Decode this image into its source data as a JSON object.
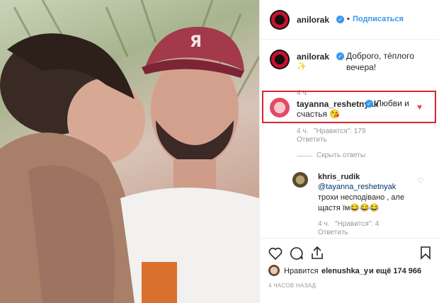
{
  "post": {
    "author": "anilorak",
    "follow_label": "Подписаться",
    "dot": "•",
    "caption": "Доброго, тёплого вечера!",
    "caption_sparkle": "✨",
    "caption_time": "4 ч.",
    "time_ago": "4 ЧАСОВ НАЗАД"
  },
  "comment": {
    "author": "tayanna_reshetnyak",
    "text_line1": "Любви и",
    "text_line2": "счастья 😘",
    "time": "4 ч.",
    "likes": "\"Нравится\": 179",
    "reply_label": "Ответить",
    "hide_replies": "Скрыть ответы"
  },
  "reply": {
    "author": "khris_rudik",
    "mention": "@tayanna_reshetnyak",
    "text_line2": "трохи несподівано , але",
    "text_line3": "щастя їм😂😂😂",
    "time": "4 ч.",
    "likes": "\"Нравится\": 4",
    "reply_label": "Ответить"
  },
  "likes_bar": {
    "prefix": "Нравится",
    "user": "elenushka_y",
    "suffix": "и ещё 174 966"
  },
  "colors": {
    "accent": "#3897f0",
    "highlight_border": "#d9262c",
    "heart": "#ed4956"
  }
}
